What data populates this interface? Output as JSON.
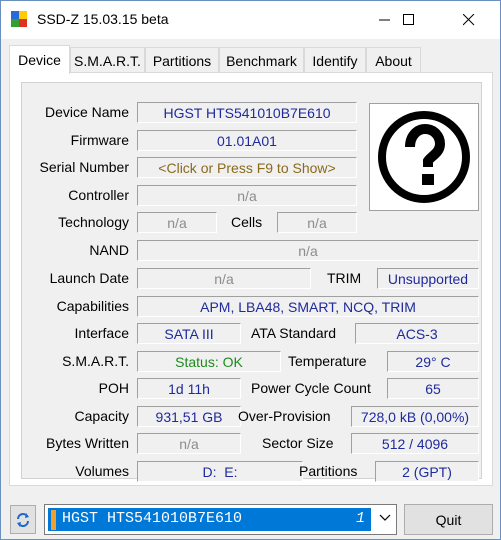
{
  "window": {
    "title": "SSD-Z 15.03.15 beta"
  },
  "tabs": [
    "Device",
    "S.M.A.R.T.",
    "Partitions",
    "Benchmark",
    "Identify",
    "About"
  ],
  "device": {
    "device_name_label": "Device Name",
    "device_name": "HGST HTS541010B7E610",
    "firmware_label": "Firmware",
    "firmware": "01.01A01",
    "serial_label": "Serial Number",
    "serial": "<Click or Press F9 to Show>",
    "controller_label": "Controller",
    "controller": "n/a",
    "technology_label": "Technology",
    "technology": "n/a",
    "cells_label": "Cells",
    "cells": "n/a",
    "nand_label": "NAND",
    "nand": "n/a",
    "launch_label": "Launch Date",
    "launch": "n/a",
    "trim_label": "TRIM",
    "trim": "Unsupported",
    "capabilities_label": "Capabilities",
    "capabilities": "APM, LBA48, SMART, NCQ, TRIM",
    "interface_label": "Interface",
    "interface": "SATA III",
    "ata_label": "ATA Standard",
    "ata": "ACS-3",
    "smart_label": "S.M.A.R.T.",
    "smart": "Status: OK",
    "temp_label": "Temperature",
    "temp": "29° C",
    "poh_label": "POH",
    "poh": "1d 11h",
    "pcc_label": "Power Cycle Count",
    "pcc": "65",
    "capacity_label": "Capacity",
    "capacity": "931,51 GB",
    "op_label": "Over-Provision",
    "op": "728,0 kB (0,00%)",
    "bw_label": "Bytes Written",
    "bw": "n/a",
    "sector_label": "Sector Size",
    "sector": "512 / 4096",
    "volumes_label": "Volumes",
    "volumes": "D:  E:",
    "partitions_label": "Partitions",
    "partitions": "2 (GPT)",
    "image_icon": "question-mark-icon"
  },
  "footer": {
    "drive_selected": "HGST HTS541010B7E610",
    "drive_number": "1",
    "quit_label": "Quit"
  },
  "colors": {
    "value_blue": "#1f2a9c",
    "na_gray": "#8c8c8c",
    "ok_green": "#1e8a1e",
    "selection": "#0078d7"
  }
}
